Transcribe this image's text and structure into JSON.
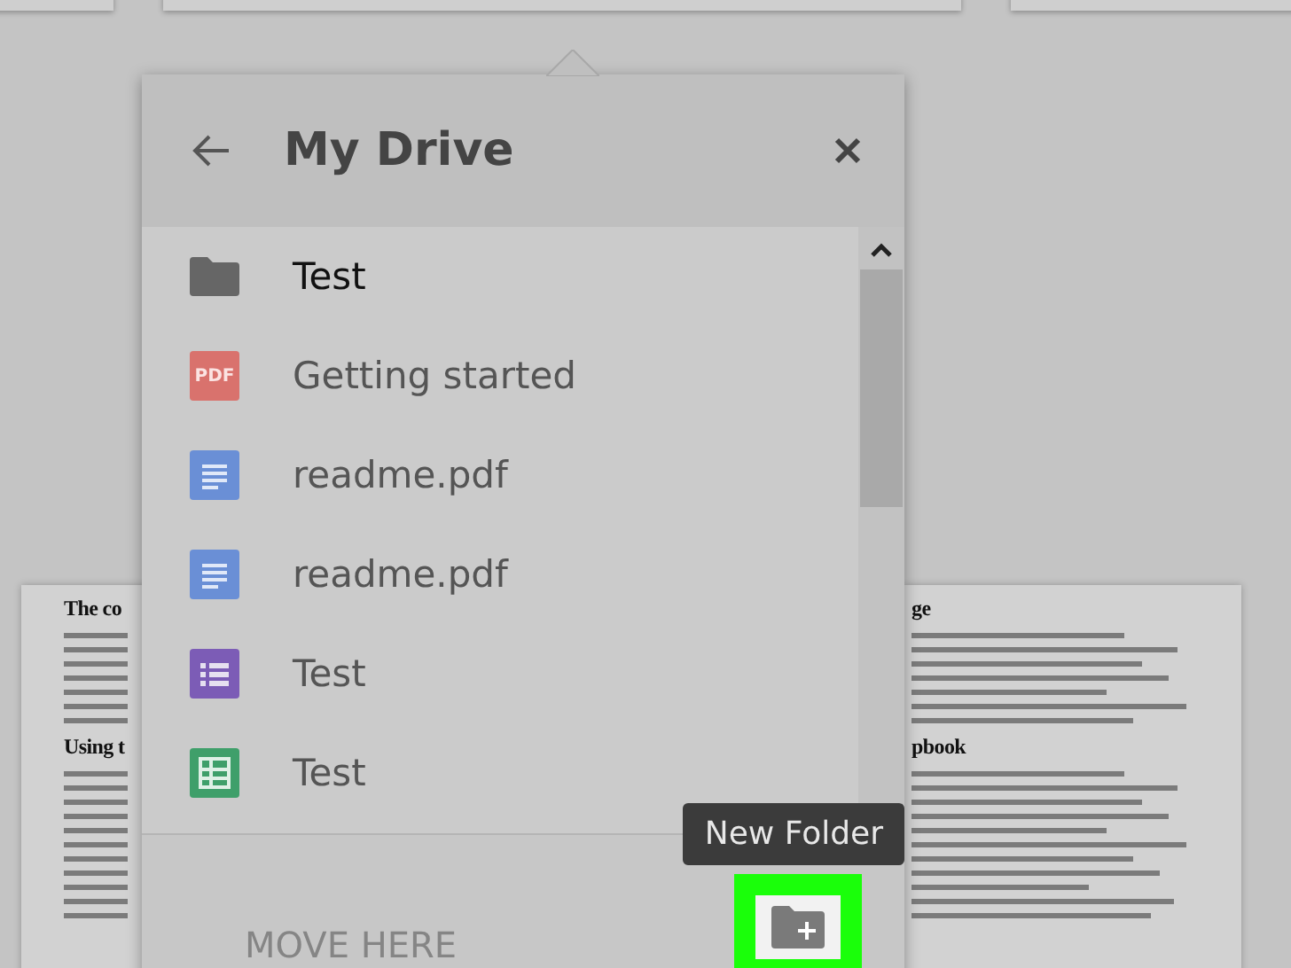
{
  "documents": [
    {
      "headings": [
        "The co",
        "Using t"
      ]
    },
    {
      "headings": [
        "ge",
        "pbook"
      ]
    }
  ],
  "dialog": {
    "title": "My Drive",
    "items": [
      {
        "name": "Test",
        "kind": "folder",
        "selected": true
      },
      {
        "name": "Getting started",
        "kind": "pdf",
        "icon_text": "PDF",
        "selected": false
      },
      {
        "name": "readme.pdf",
        "kind": "doc",
        "selected": false
      },
      {
        "name": "readme.pdf",
        "kind": "doc",
        "selected": false
      },
      {
        "name": "Test",
        "kind": "form",
        "selected": false
      },
      {
        "name": "Test",
        "kind": "sheet",
        "selected": false
      }
    ],
    "move_button": {
      "label": "MOVE HERE",
      "disabled": true
    },
    "new_folder": {
      "tooltip": "New Folder",
      "highlighted": true
    }
  }
}
